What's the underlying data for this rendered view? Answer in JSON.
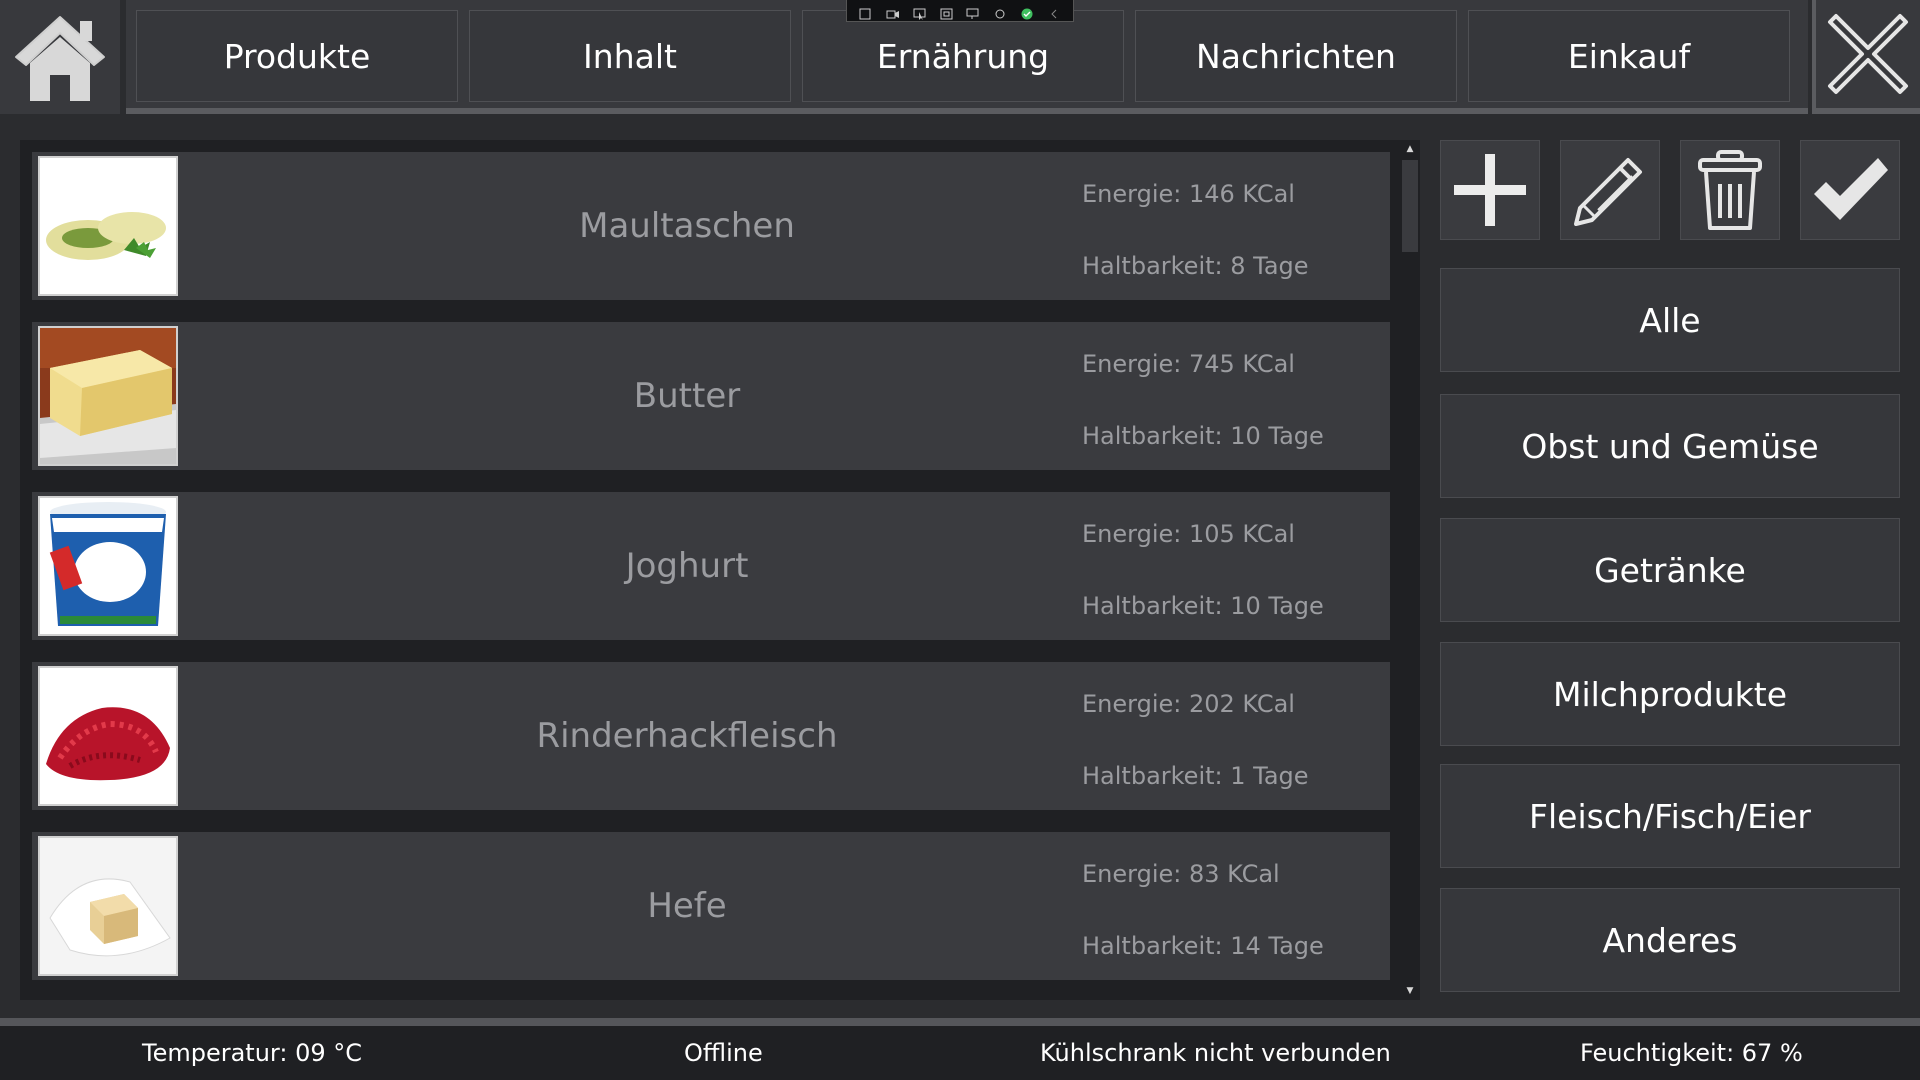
{
  "nav": {
    "tabs": [
      {
        "label": "Produkte"
      },
      {
        "label": "Inhalt"
      },
      {
        "label": "Ernährung"
      },
      {
        "label": "Nachrichten"
      },
      {
        "label": "Einkauf"
      }
    ]
  },
  "icons": {
    "home": "home-icon",
    "close": "close-icon",
    "add": "plus-icon",
    "edit": "pencil-icon",
    "delete": "trash-icon",
    "confirm": "checkmark-icon"
  },
  "products": [
    {
      "name": "Maultaschen",
      "energy": "Energie: 146 KCal",
      "shelf": "Haltbarkeit: 8 Tage",
      "image": "maultaschen-image"
    },
    {
      "name": "Butter",
      "energy": "Energie: 745 KCal",
      "shelf": "Haltbarkeit: 10 Tage",
      "image": "butter-image"
    },
    {
      "name": "Joghurt",
      "energy": "Energie: 105 KCal",
      "shelf": "Haltbarkeit: 10 Tage",
      "image": "joghurt-image"
    },
    {
      "name": "Rinderhackfleisch",
      "energy": "Energie: 202 KCal",
      "shelf": "Haltbarkeit: 1 Tage",
      "image": "hackfleisch-image"
    },
    {
      "name": "Hefe",
      "energy": "Energie: 83 KCal",
      "shelf": "Haltbarkeit: 14 Tage",
      "image": "hefe-image"
    }
  ],
  "categories": [
    {
      "label": "Alle"
    },
    {
      "label": "Obst und Gemüse"
    },
    {
      "label": "Getränke"
    },
    {
      "label": "Milchprodukte"
    },
    {
      "label": "Fleisch/Fisch/Eier"
    },
    {
      "label": "Anderes"
    }
  ],
  "status": {
    "temperature": "Temperatur: 09 °C",
    "connection": "Offline",
    "fridge": "Kühlschrank nicht verbunden",
    "humidity": "Feuchtigkeit: 67 %"
  },
  "colors": {
    "background": "#2b2c2f",
    "card": "#3a3b3f",
    "text_muted": "#9b9ca0",
    "text": "#ffffff"
  }
}
